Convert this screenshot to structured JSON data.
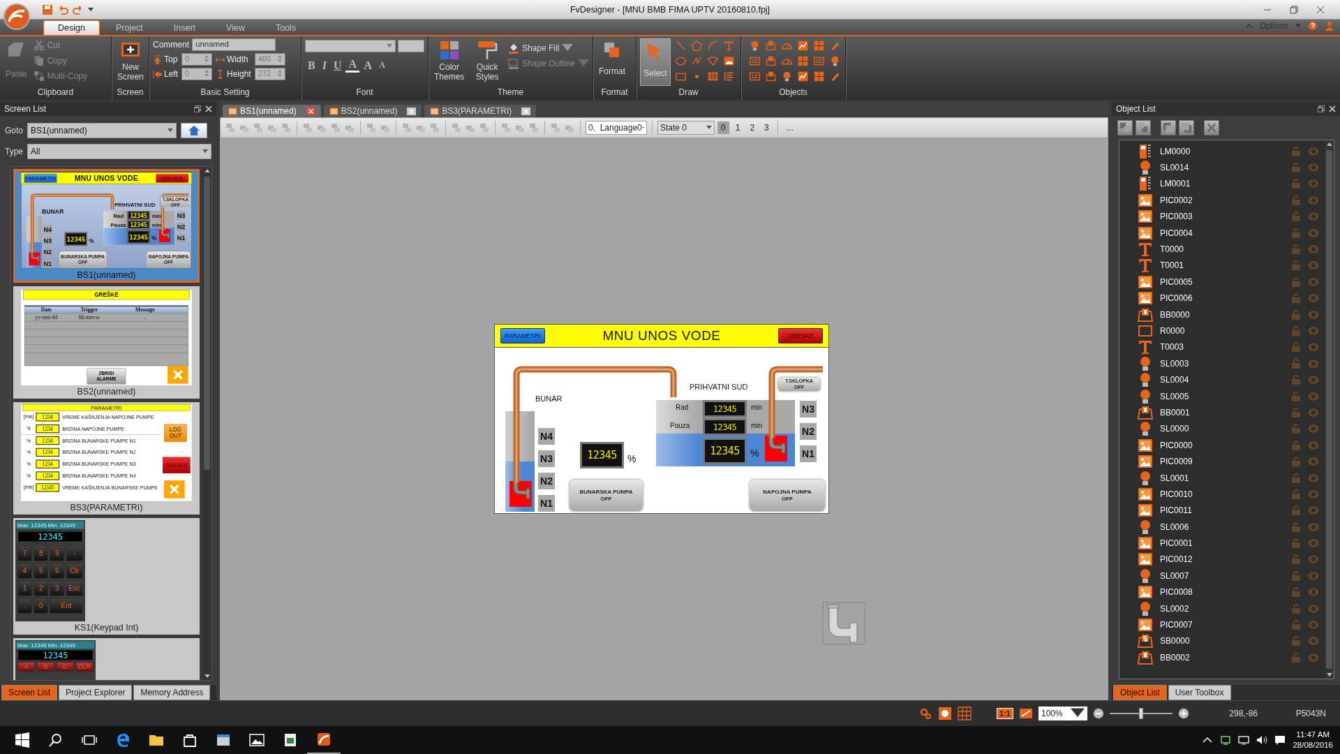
{
  "title_bar": {
    "title": "FvDesigner - [MNU BMB FIMA UPTV 20160810.fpj]"
  },
  "ribbon_tabs": [
    {
      "label": "Design",
      "selected": true
    },
    {
      "label": "Project",
      "selected": false
    },
    {
      "label": "Insert",
      "selected": false
    },
    {
      "label": "View",
      "selected": false
    },
    {
      "label": "Tools",
      "selected": false
    }
  ],
  "options": {
    "label": "Options"
  },
  "ribbon": {
    "clipboard": {
      "label": "Clipboard",
      "paste": {
        "label": "Paste",
        "disabled": true
      },
      "commands": [
        {
          "label": "Cut",
          "kind": "cut",
          "disabled": true
        },
        {
          "label": "Copy",
          "kind": "copy",
          "disabled": true
        },
        {
          "label": "Multi-Copy",
          "kind": "multi",
          "disabled": true
        }
      ]
    },
    "screen": {
      "label": "Screen",
      "new_screen": "New Screen"
    },
    "basic_setting": {
      "label": "Basic Setting",
      "comment": {
        "label": "Comment",
        "value": "unnamed"
      },
      "top": {
        "label": "Top",
        "value": "0"
      },
      "width": {
        "label": "Width",
        "value": "480"
      },
      "left": {
        "label": "Left",
        "value": "0"
      },
      "height": {
        "label": "Height",
        "value": "272"
      }
    },
    "font": {
      "label": "Font",
      "buttons": [
        {
          "label": "B",
          "kind": "bold"
        },
        {
          "label": "I",
          "kind": "italic"
        },
        {
          "label": "U",
          "kind": "underline"
        },
        {
          "label": "A",
          "kind": "color"
        },
        {
          "label": "A",
          "kind": "grow"
        },
        {
          "label": "A",
          "kind": "shrink"
        }
      ]
    },
    "theme": {
      "label": "Theme",
      "color_themes": "Color Themes",
      "quick_styles": "Quick Styles",
      "shape_fill": {
        "label": "Shape Fill",
        "disabled": false
      },
      "shape_outline": {
        "label": "Shape Outline",
        "disabled": true
      }
    },
    "format": {
      "label": "Format",
      "button": "Format"
    },
    "draw": {
      "label": "Draw",
      "select": {
        "label": "Select",
        "selected": true
      }
    },
    "objects": {
      "label": "Objects"
    }
  },
  "screen_list": {
    "title": "Screen List",
    "goto_label": "Goto",
    "goto_value": "BS1(unnamed)",
    "type_label": "Type",
    "type_value": "All",
    "screens": [
      {
        "kind": "main",
        "caption": "BS1(unnamed)",
        "selected": true,
        "preview": {
          "title": "MNU UNOS VODE",
          "parameters_button": "PARAMETRI",
          "alarms_button": "GRESKE",
          "well_label": "BUNAR",
          "tank_label": "PRIHVATNI SUD",
          "well_tank": {
            "level": 0.5
          },
          "well_indicators": [
            "N4",
            "N3",
            "N2",
            "N1"
          ],
          "well_display": {
            "value": "12345",
            "unit": "%"
          },
          "well_pump_button": {
            "label": "BUNARSKA PUMPA",
            "state": "OFF"
          },
          "tank": {
            "level": 0.5,
            "rows": [
              {
                "label": "Rad",
                "value": "12345",
                "unit": "min"
              },
              {
                "label": "Pauza",
                "value": "12345",
                "unit": "min"
              }
            ],
            "level_display": {
              "value": "12345",
              "unit": "%"
            }
          },
          "switch_button": {
            "label": "T.SKLOPKA",
            "state": "OFF"
          },
          "tank_indicators": [
            "N3",
            "N2",
            "N1"
          ],
          "feed_pump_button": {
            "label": "NAPOJNA PUMPA",
            "state": "OFF"
          }
        }
      },
      {
        "kind": "alarms",
        "caption": "BS2(unnamed)",
        "selected": false,
        "preview": {
          "title": "GREŠKE",
          "columns": [
            "Date",
            "Trigger",
            "Message"
          ],
          "row": [
            "yy-mm-dd",
            "hh:mm:ss",
            "..."
          ],
          "button": "ZBRISI ALARME"
        }
      },
      {
        "kind": "parameters",
        "caption": "BS3(PARAMETRI)",
        "selected": false,
        "preview": {
          "title": "PARAMETRI",
          "rows": [
            {
              "unit": "[min]",
              "value": "1234",
              "label": "VREME KAŠNJENJA NAPOJNE PUMPE"
            },
            {
              "unit": "%",
              "value": "1234",
              "label": "BRZINA NAPOJNE PUMPE"
            },
            {
              "unit": "%",
              "value": "1234",
              "label": "BRZINA BUNARSKE PUMPE N1"
            },
            {
              "unit": "%",
              "value": "1234",
              "label": "BRZINA BUNARSKE PUMPE N2"
            },
            {
              "unit": "%",
              "value": "1234",
              "label": "BRZINA BUNARSKE PUMPE N3"
            },
            {
              "unit": "%",
              "value": "1234",
              "label": "BRZINA BUNARSKE PUMPE N4"
            },
            {
              "unit": "[min]",
              "value": "12345",
              "label": "VREME KAŠNJENJA BUNARSKE PUMPE"
            }
          ],
          "logout_button": "LOG OUT",
          "alarms_button": "GRESKE"
        }
      },
      {
        "kind": "keypad",
        "caption": "KS1(Keypad Int)",
        "selected": false,
        "preview": {
          "max_label": "Max.",
          "max": "12345",
          "min_label": "Min.",
          "min": "12345",
          "display": "12345",
          "keys": [
            "7",
            "8",
            "9",
            "-",
            "4",
            "5",
            "6",
            "Clr",
            "1",
            "2",
            "3",
            "Esc",
            ".",
            "0",
            "Ent"
          ]
        }
      },
      {
        "kind": "keypad",
        "selected": false,
        "preview": {
          "max_label": "Max.",
          "max": "12345",
          "min_label": "Min.",
          "min": "12345",
          "display": "12345",
          "keys": [
            "A",
            "B",
            "C",
            "CLR"
          ]
        }
      }
    ],
    "tabs": [
      {
        "label": "Screen List",
        "selected": true
      },
      {
        "label": "Project Explorer",
        "selected": false
      },
      {
        "label": "Memory Address",
        "selected": false
      }
    ]
  },
  "editor": {
    "tabs": [
      {
        "label": "BS1(unnamed)",
        "selected": true
      },
      {
        "label": "BS2(unnamed)",
        "selected": false
      },
      {
        "label": "BS3(PARAMETRI)",
        "selected": false
      }
    ],
    "language": "0.  Language0",
    "state_select": "State 0",
    "states": [
      {
        "label": "0",
        "selected": true
      },
      {
        "label": "1",
        "selected": false
      },
      {
        "label": "2",
        "selected": false
      },
      {
        "label": "3",
        "selected": false
      }
    ],
    "more": "..."
  },
  "hmi": {
    "title": "MNU UNOS VODE",
    "parameters_button": "PARAMETRI",
    "alarms_button": "GRESKE",
    "well_label": "BUNAR",
    "tank_label": "PRIHVATNI SUD",
    "well_tank": {
      "level": 0.5
    },
    "well_indicators": [
      "N4",
      "N3",
      "N2",
      "N1"
    ],
    "well_display": {
      "value": "12345",
      "unit": "%"
    },
    "well_pump_button": {
      "label": "BUNARSKA PUMPA",
      "state": "OFF"
    },
    "tank": {
      "level": 0.5,
      "rows": [
        {
          "label": "Rad",
          "value": "12345",
          "unit": "min"
        },
        {
          "label": "Pauza",
          "value": "12345",
          "unit": "min"
        }
      ],
      "level_display": {
        "value": "12345",
        "unit": "%"
      }
    },
    "switch_button": {
      "label": "T.SKLOPKA",
      "state": "OFF"
    },
    "tank_indicators": [
      "N3",
      "N2",
      "N1"
    ],
    "feed_pump_button": {
      "label": "NAPOJNA PUMPA",
      "state": "OFF"
    }
  },
  "object_list": {
    "title": "Object List",
    "objects": [
      {
        "name": "LM0000",
        "kind": "meter"
      },
      {
        "name": "SL0014",
        "kind": "lamp"
      },
      {
        "name": "LM0001",
        "kind": "meter"
      },
      {
        "name": "PIC0002",
        "kind": "picture"
      },
      {
        "name": "PIC0003",
        "kind": "picture"
      },
      {
        "name": "PIC0004",
        "kind": "picture"
      },
      {
        "name": "T0000",
        "kind": "text"
      },
      {
        "name": "T0001",
        "kind": "text"
      },
      {
        "name": "PIC0005",
        "kind": "picture"
      },
      {
        "name": "PIC0006",
        "kind": "picture"
      },
      {
        "name": "BB0000",
        "kind": "bit_button"
      },
      {
        "name": "R0000",
        "kind": "rectangle"
      },
      {
        "name": "T0003",
        "kind": "text"
      },
      {
        "name": "SL0003",
        "kind": "lamp"
      },
      {
        "name": "SL0004",
        "kind": "lamp"
      },
      {
        "name": "SL0005",
        "kind": "lamp"
      },
      {
        "name": "BB0001",
        "kind": "bit_button"
      },
      {
        "name": "SL0000",
        "kind": "lamp"
      },
      {
        "name": "PIC0000",
        "kind": "picture"
      },
      {
        "name": "PIC0009",
        "kind": "picture"
      },
      {
        "name": "SL0001",
        "kind": "lamp"
      },
      {
        "name": "PIC0010",
        "kind": "picture"
      },
      {
        "name": "PIC0011",
        "kind": "picture"
      },
      {
        "name": "SL0006",
        "kind": "lamp"
      },
      {
        "name": "PIC0001",
        "kind": "picture"
      },
      {
        "name": "PIC0012",
        "kind": "picture"
      },
      {
        "name": "SL0007",
        "kind": "lamp"
      },
      {
        "name": "PIC0008",
        "kind": "picture"
      },
      {
        "name": "SL0002",
        "kind": "lamp"
      },
      {
        "name": "PIC0007",
        "kind": "picture"
      },
      {
        "name": "SB0000",
        "kind": "switch_button"
      },
      {
        "name": "BB0002",
        "kind": "bit_button"
      }
    ],
    "tabs": [
      {
        "label": "Object List",
        "selected": true
      },
      {
        "label": "User Toolbox",
        "selected": false
      }
    ]
  },
  "status_bar": {
    "ratio_button": "1:1",
    "zoom": "100%",
    "zoom_slider": {
      "level": 0.5
    },
    "coordinates": "298,-86",
    "model": "P5043N"
  },
  "taskbar": {
    "time": "11:47 AM",
    "date": "28/08/2016"
  }
}
